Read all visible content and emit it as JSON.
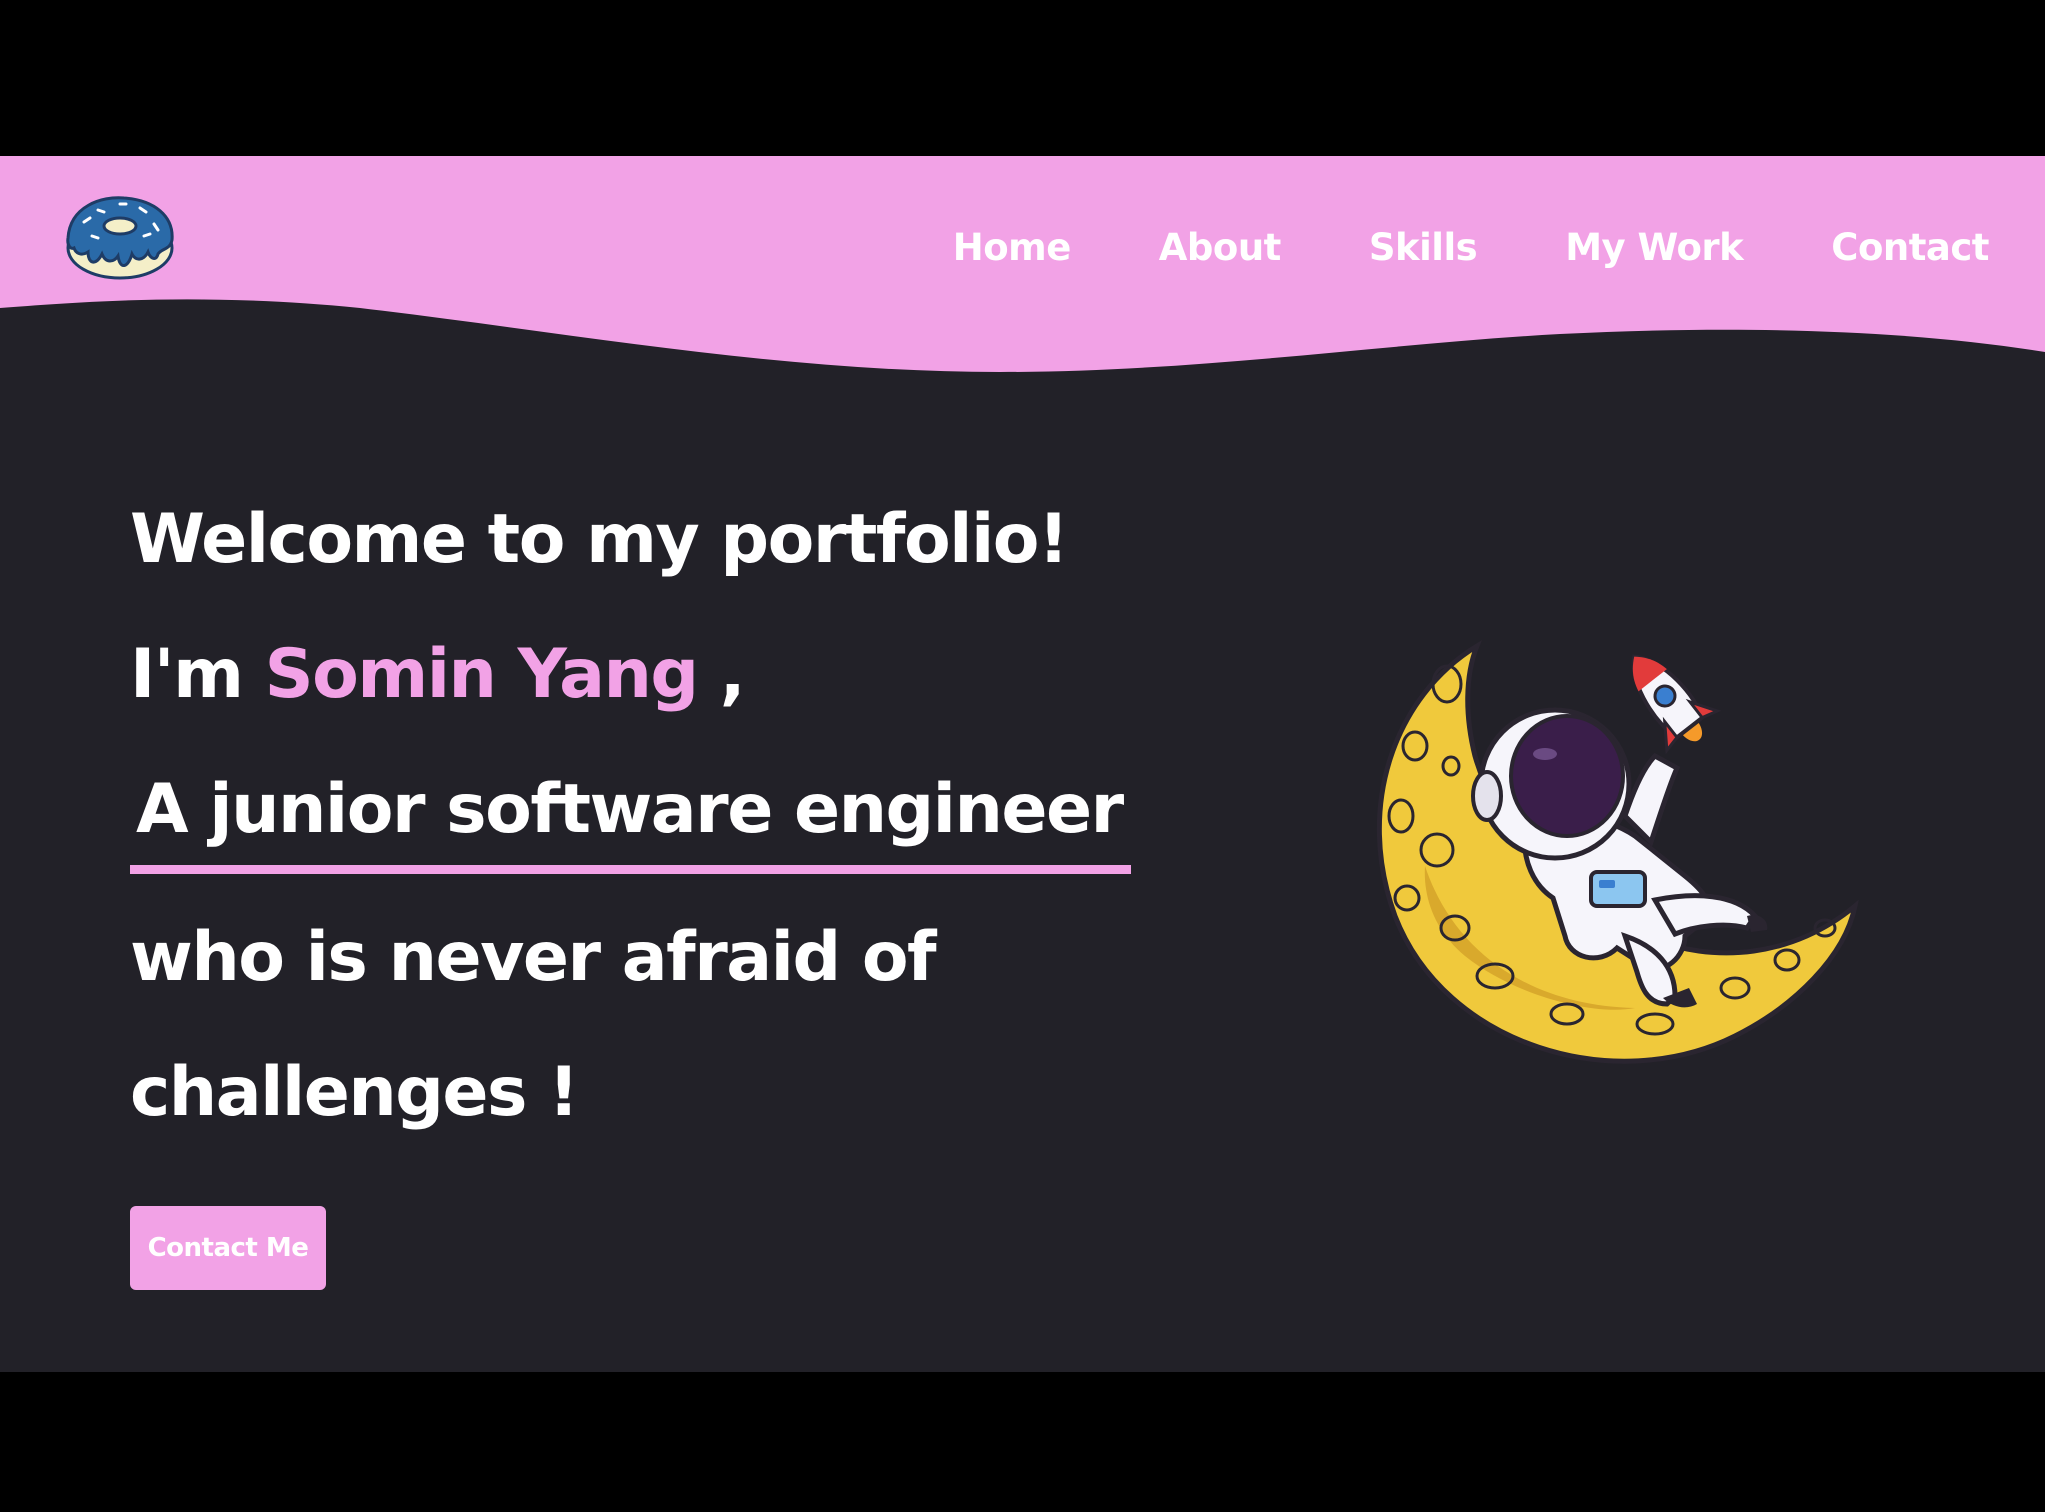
{
  "header": {
    "logo_icon": "donut-icon",
    "background_color": "#f2a2e6"
  },
  "nav": {
    "items": [
      {
        "label": "Home"
      },
      {
        "label": "About"
      },
      {
        "label": "Skills"
      },
      {
        "label": "My Work"
      },
      {
        "label": "Contact"
      }
    ]
  },
  "hero": {
    "welcome": "Welcome to my portfolio!",
    "intro_prefix": "I'm ",
    "name": "Somin Yang",
    "intro_suffix": " ,",
    "role": "A junior software engineer",
    "tagline_1": "who is never afraid of",
    "tagline_2": "challenges !",
    "accent_color": "#f2a2e6",
    "text_color": "#ffffff",
    "background_color": "#222128"
  },
  "cta": {
    "label": "Contact Me"
  },
  "illustration": {
    "icon": "astronaut-on-moon-icon"
  }
}
